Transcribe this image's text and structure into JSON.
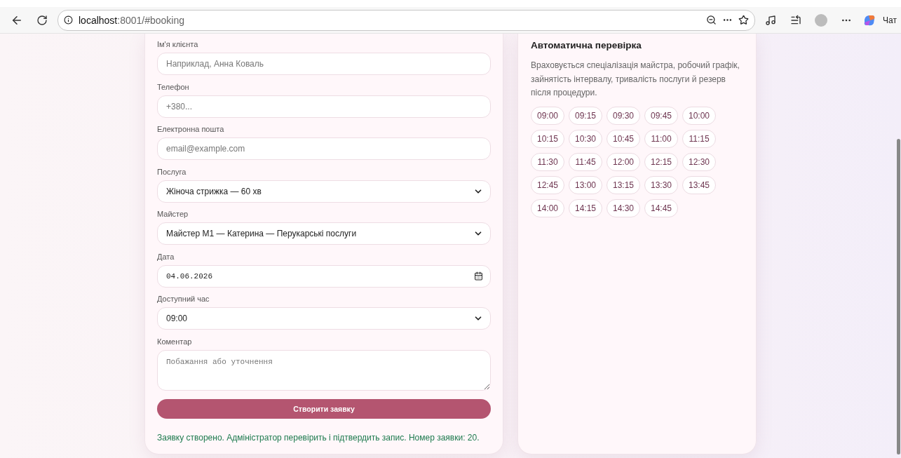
{
  "browser": {
    "url_host": "localhost",
    "url_rest": ":8001/#booking",
    "chat_label": "Чат"
  },
  "form": {
    "fields": [
      {
        "kind": "input",
        "label": "Ім'я клієнта",
        "placeholder": "Наприклад, Анна Коваль"
      },
      {
        "kind": "input",
        "label": "Телефон",
        "placeholder": "+380..."
      },
      {
        "kind": "input",
        "label": "Електронна пошта",
        "placeholder": "email@example.com"
      },
      {
        "kind": "select",
        "label": "Послуга",
        "value": "Жіноча стрижка — 60 хв"
      },
      {
        "kind": "select",
        "label": "Майстер",
        "value": "Майстер M1 — Катерина — Перукарські послуги"
      },
      {
        "kind": "date",
        "label": "Дата",
        "value": "04.06.2026"
      },
      {
        "kind": "select",
        "label": "Доступний час",
        "value": "09:00"
      },
      {
        "kind": "textarea",
        "label": "Коментар",
        "placeholder": "Побажання або уточнення"
      }
    ],
    "submit": "Створити заявку",
    "message": "Заявку створено. Адміністратор перевірить і підтвердить запис. Номер заявки: 20."
  },
  "check": {
    "title": "Автоматична перевірка",
    "description": "Враховується спеціалізація майстра, робочий графік, зайнятість інтервалу, тривалість послуги й резерв після процедури.",
    "slots": [
      "09:00",
      "09:15",
      "09:30",
      "09:45",
      "10:00",
      "10:15",
      "10:30",
      "10:45",
      "11:00",
      "11:15",
      "11:30",
      "11:45",
      "12:00",
      "12:15",
      "12:30",
      "12:45",
      "13:00",
      "13:15",
      "13:30",
      "13:45",
      "14:00",
      "14:15",
      "14:30",
      "14:45"
    ]
  }
}
